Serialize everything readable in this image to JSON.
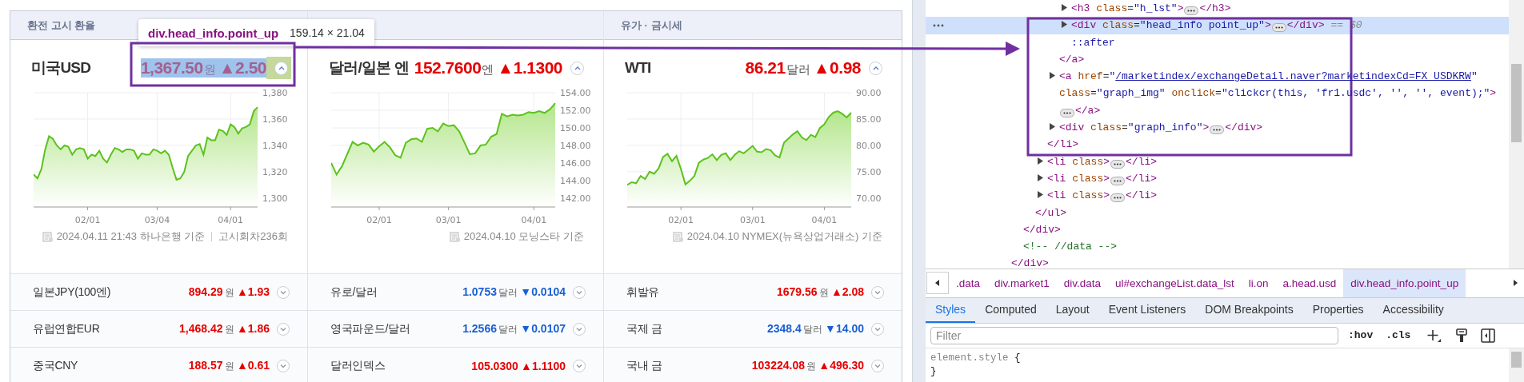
{
  "market": {
    "headlines": [
      {
        "section_title": "환전 고시 환율",
        "name": "미국USD",
        "value": "1,367.50",
        "unit": "원",
        "change": "▲2.50",
        "rising": true,
        "highlighted": true,
        "chart_data": {
          "type": "area",
          "categories": [
            null,
            null,
            null,
            null,
            null,
            null,
            null,
            null,
            null,
            null,
            null,
            null,
            null,
            null,
            "02/01",
            null,
            null,
            null,
            null,
            null,
            null,
            null,
            null,
            null,
            null,
            null,
            null,
            null,
            null,
            null,
            null,
            null,
            "03/04",
            null,
            null,
            null,
            null,
            null,
            null,
            null,
            null,
            null,
            null,
            null,
            null,
            null,
            null,
            null,
            null,
            null,
            null,
            "04/01",
            null,
            null,
            null,
            null,
            null,
            null,
            null
          ],
          "series": [
            {
              "color": "#5cc21d",
              "values": [
                1318,
                1315,
                1322,
                1337,
                1347,
                1345,
                1340,
                1337,
                1340,
                1339,
                1333,
                1337,
                1338,
                1337,
                1330,
                1333,
                1332,
                1336,
                1330,
                1327,
                1333,
                1338,
                1337,
                1335,
                1337,
                1337,
                1336,
                1330,
                1334,
                1333,
                1333,
                1337,
                1336,
                1334,
                1336,
                1333,
                1323,
                1314,
                1315,
                1320,
                1332,
                1336,
                1340,
                1341,
                1333,
                1346,
                1344,
                1344,
                1352,
                1351,
                1348,
                1356,
                1354,
                1349,
                1353,
                1354,
                1356,
                1366,
                1369
              ]
            }
          ],
          "grid": true,
          "ylim": [
            1293.3,
            1380
          ],
          "yticks": [
            {
              "value": 1380,
              "label": "1,380"
            },
            {
              "value": 1360,
              "label": "1,360"
            },
            {
              "value": 1340,
              "label": "1,340"
            },
            {
              "value": 1320,
              "label": "1,320"
            },
            {
              "value": 1300,
              "label": "1,300"
            }
          ]
        },
        "footer": {
          "text": "2024.04.11 21:43 하나은행 기준",
          "extra": "고시회차236회"
        }
      },
      {
        "name": "달러/일본 엔",
        "value": "152.7600",
        "unit": "엔",
        "change": "▲1.1300",
        "rising": true,
        "highlighted": false,
        "chart_data": {
          "type": "area",
          "categories": [
            null,
            null,
            null,
            null,
            null,
            null,
            null,
            null,
            null,
            "02/01",
            null,
            null,
            null,
            null,
            null,
            null,
            null,
            null,
            null,
            null,
            null,
            null,
            "03/01",
            null,
            null,
            null,
            null,
            null,
            null,
            null,
            null,
            null,
            null,
            null,
            null,
            null,
            null,
            null,
            "04/01",
            null,
            null,
            null,
            null
          ],
          "series": [
            {
              "color": "#5cc21d",
              "values": [
                146.0,
                144.7,
                145.6,
                147.0,
                148.4,
                148.0,
                148.3,
                148.1,
                147.3,
                147.9,
                148.4,
                147.8,
                146.9,
                146.6,
                148.3,
                148.7,
                148.8,
                148.4,
                149.9,
                150.0,
                149.6,
                150.5,
                150.2,
                150.3,
                149.6,
                148.3,
                147.0,
                147.1,
                148.0,
                148.1,
                149.0,
                149.3,
                151.6,
                151.3,
                151.5,
                151.4,
                151.5,
                151.8,
                151.7,
                151.9,
                151.7,
                152.1,
                152.8
              ]
            }
          ],
          "grid": true,
          "ylim": [
            141,
            154
          ],
          "yticks": [
            {
              "value": 154,
              "label": "154.00"
            },
            {
              "value": 152,
              "label": "152.00"
            },
            {
              "value": 150,
              "label": "150.00"
            },
            {
              "value": 148,
              "label": "148.00"
            },
            {
              "value": 146,
              "label": "146.00"
            },
            {
              "value": 144,
              "label": "144.00"
            },
            {
              "value": 142,
              "label": "142.00"
            }
          ]
        },
        "footer": {
          "text": "2024.04.10 모닝스타 기준"
        }
      },
      {
        "section_title": "유가 · 금시세",
        "name": "WTI",
        "value": "86.21",
        "unit": "달러",
        "change": "▲0.98",
        "rising": true,
        "highlighted": false,
        "chart_data": {
          "type": "area",
          "categories": [
            null,
            null,
            null,
            null,
            null,
            null,
            null,
            null,
            null,
            null,
            null,
            null,
            "02/01",
            null,
            null,
            null,
            null,
            null,
            null,
            null,
            null,
            null,
            null,
            null,
            null,
            null,
            null,
            null,
            "03/01",
            null,
            null,
            null,
            null,
            null,
            null,
            null,
            null,
            null,
            null,
            null,
            null,
            null,
            null,
            null,
            "04/01",
            null,
            null,
            null,
            null,
            null,
            null
          ],
          "series": [
            {
              "color": "#5cc21d",
              "values": [
                72.5,
                73.0,
                72.8,
                74.2,
                73.6,
                75.0,
                74.6,
                75.6,
                77.8,
                78.4,
                77.0,
                78.0,
                75.5,
                72.6,
                73.3,
                74.2,
                76.7,
                77.3,
                77.6,
                78.3,
                77.2,
                78.2,
                78.5,
                77.2,
                78.2,
                78.9,
                78.5,
                79.2,
                79.9,
                78.8,
                78.7,
                79.3,
                79.1,
                78.1,
                77.7,
                80.5,
                81.3,
                82.1,
                82.7,
                81.5,
                81.0,
                82.0,
                81.6,
                83.3,
                84.0,
                85.4,
                86.2,
                86.5,
                86.0,
                85.3,
                86.2
              ]
            }
          ],
          "grid": true,
          "ylim": [
            68.3,
            90
          ],
          "yticks": [
            {
              "value": 90,
              "label": "90.00"
            },
            {
              "value": 85,
              "label": "85.00"
            },
            {
              "value": 80,
              "label": "80.00"
            },
            {
              "value": 75,
              "label": "75.00"
            },
            {
              "value": 70,
              "label": "70.00"
            }
          ]
        },
        "footer": {
          "text": "2024.04.10 NYMEX(뉴욕상업거래소) 기준"
        }
      }
    ],
    "rows": [
      {
        "cells": [
          {
            "name": "일본JPY(100엔)",
            "value": "894.29",
            "unit": "원",
            "change": "▲1.93",
            "rising": true
          },
          {
            "name": "유로/달러",
            "value": "1.0753",
            "unit": "달러",
            "change": "▼0.0104",
            "rising": false
          },
          {
            "name": "휘발유",
            "value": "1679.56",
            "unit": "원",
            "change": "▲2.08",
            "rising": true
          }
        ]
      },
      {
        "cells": [
          {
            "name": "유럽연합EUR",
            "value": "1,468.42",
            "unit": "원",
            "change": "▲1.86",
            "rising": true
          },
          {
            "name": "영국파운드/달러",
            "value": "1.2566",
            "unit": "달러",
            "change": "▼0.0107",
            "rising": false
          },
          {
            "name": "국제 금",
            "value": "2348.4",
            "unit": "달러",
            "change": "▼14.00",
            "rising": false
          }
        ]
      },
      {
        "cells": [
          {
            "name": "중국CNY",
            "value": "188.57",
            "unit": "원",
            "change": "▲0.61",
            "rising": true
          },
          {
            "name": "달러인덱스",
            "value": "105.0300",
            "change": "▲1.1100",
            "rising": true
          },
          {
            "name": "국내 금",
            "value": "103224.08",
            "unit": "원",
            "change": "▲496.30",
            "rising": true
          }
        ]
      }
    ]
  },
  "inspector_tooltip": {
    "selector": "div.head_info.point_up",
    "size": "159.14 × 21.04"
  },
  "devtools": {
    "dom_tree": [
      {
        "selected": false,
        "close": [
          {
            "kind": "tag",
            "text": "</div>"
          }
        ],
        "children": [
          {
            "selected": false,
            "close": [
              {
                "kind": "tag",
                "text": "</div>"
              }
            ],
            "children": [
              {
                "selected": false,
                "close": [
                  {
                    "kind": "tag",
                    "text": "</ul>"
                  }
                ],
                "children": [
                  {
                    "selected": false,
                    "close": [
                      {
                        "kind": "tag",
                        "text": "</li>"
                      }
                    ],
                    "children": [
                      {
                        "selected": false,
                        "close": [
                          {
                            "kind": "tag",
                            "text": "</a>"
                          }
                        ],
                        "children": [
                          {
                            "selected": false,
                            "expanded": false,
                            "open": [
                              {
                                "kind": "tag",
                                "text": "<h3"
                              },
                              {
                                "kind": "attr",
                                "text": " class"
                              },
                              {
                                "kind": "plain",
                                "text": "="
                              },
                              {
                                "kind": "value",
                                "text": "\"h_lst\""
                              },
                              {
                                "kind": "tag",
                                "text": ">"
                              }
                            ],
                            "close": [
                              {
                                "kind": "tag",
                                "text": "</h3>"
                              }
                            ]
                          },
                          {
                            "selected": true,
                            "expanded": false,
                            "open": [
                              {
                                "kind": "tag",
                                "text": "<div"
                              },
                              {
                                "kind": "attr",
                                "text": " class"
                              },
                              {
                                "kind": "plain",
                                "text": "="
                              },
                              {
                                "kind": "value",
                                "text": "\"head_info point_up\""
                              },
                              {
                                "kind": "tag",
                                "text": ">"
                              }
                            ],
                            "close": [
                              {
                                "kind": "tag",
                                "text": "</div>"
                              }
                            ],
                            "note": "== $0"
                          },
                          {
                            "selected": false,
                            "open": [
                              {
                                "kind": "pseudo",
                                "text": "::after"
                              }
                            ]
                          }
                        ]
                      },
                      {
                        "selected": false,
                        "expanded": false,
                        "open": [
                          {
                            "kind": "tag",
                            "text": "<a"
                          },
                          {
                            "kind": "attr",
                            "text": " href"
                          },
                          {
                            "kind": "plain",
                            "text": "="
                          },
                          {
                            "kind": "value",
                            "text": "\""
                          },
                          {
                            "kind": "link",
                            "text": "/marketindex/exchangeDetail.naver?marketindexCd=FX_USDKRW"
                          },
                          {
                            "kind": "value",
                            "text": "\""
                          },
                          {
                            "kind": "attr",
                            "text": " class"
                          },
                          {
                            "kind": "plain",
                            "text": "="
                          },
                          {
                            "kind": "value",
                            "text": "\"graph_img\""
                          },
                          {
                            "kind": "attr",
                            "text": " onclick"
                          },
                          {
                            "kind": "plain",
                            "text": "="
                          },
                          {
                            "kind": "value",
                            "text": "\"clickcr(this, 'fr1.usdc', '', '', event);\""
                          },
                          {
                            "kind": "tag",
                            "text": ">"
                          }
                        ],
                        "close": [
                          {
                            "kind": "tag",
                            "text": "</a>"
                          }
                        ]
                      },
                      {
                        "selected": false,
                        "expanded": false,
                        "open": [
                          {
                            "kind": "tag",
                            "text": "<div"
                          },
                          {
                            "kind": "attr",
                            "text": " class"
                          },
                          {
                            "kind": "plain",
                            "text": "="
                          },
                          {
                            "kind": "value",
                            "text": "\"graph_info\""
                          },
                          {
                            "kind": "tag",
                            "text": ">"
                          }
                        ],
                        "close": [
                          {
                            "kind": "tag",
                            "text": "</div>"
                          }
                        ]
                      }
                    ]
                  },
                  {
                    "selected": false,
                    "expanded": false,
                    "open": [
                      {
                        "kind": "tag",
                        "text": "<li"
                      },
                      {
                        "kind": "attr",
                        "text": " class"
                      },
                      {
                        "kind": "tag",
                        "text": ">"
                      }
                    ],
                    "close": [
                      {
                        "kind": "tag",
                        "text": "</li>"
                      }
                    ]
                  },
                  {
                    "selected": false,
                    "expanded": false,
                    "open": [
                      {
                        "kind": "tag",
                        "text": "<li"
                      },
                      {
                        "kind": "attr",
                        "text": " class"
                      },
                      {
                        "kind": "tag",
                        "text": ">"
                      }
                    ],
                    "close": [
                      {
                        "kind": "tag",
                        "text": "</li>"
                      }
                    ]
                  },
                  {
                    "selected": false,
                    "expanded": false,
                    "open": [
                      {
                        "kind": "tag",
                        "text": "<li"
                      },
                      {
                        "kind": "attr",
                        "text": " class"
                      },
                      {
                        "kind": "tag",
                        "text": ">"
                      }
                    ],
                    "close": [
                      {
                        "kind": "tag",
                        "text": "</li>"
                      }
                    ]
                  }
                ]
              }
            ]
          },
          {
            "selected": false,
            "open": [
              {
                "kind": "comment",
                "text": "<!-- //data -->"
              }
            ]
          }
        ]
      }
    ],
    "breadcrumbs": [
      {
        "label": ".data",
        "selected": false
      },
      {
        "label": "div.market1",
        "selected": false
      },
      {
        "label": "div.data",
        "selected": false
      },
      {
        "label": "ul#exchangeList.data_lst",
        "selected": false
      },
      {
        "label": "li.on",
        "selected": false
      },
      {
        "label": "a.head.usd",
        "selected": false
      },
      {
        "label": "div.head_info.point_up",
        "selected": true
      }
    ],
    "tabs": [
      {
        "label": "Styles",
        "selected": true
      },
      {
        "label": "Computed",
        "selected": false
      },
      {
        "label": "Layout",
        "selected": false
      },
      {
        "label": "Event Listeners",
        "selected": false
      },
      {
        "label": "DOM Breakpoints",
        "selected": false
      },
      {
        "label": "Properties",
        "selected": false
      },
      {
        "label": "Accessibility",
        "selected": false
      }
    ],
    "filter": {
      "placeholder": "Filter"
    },
    "toggles": [
      ":hov",
      ".cls"
    ],
    "style_rules": [
      {
        "selector": "element.style",
        "open": "{",
        "close": "}"
      }
    ]
  }
}
